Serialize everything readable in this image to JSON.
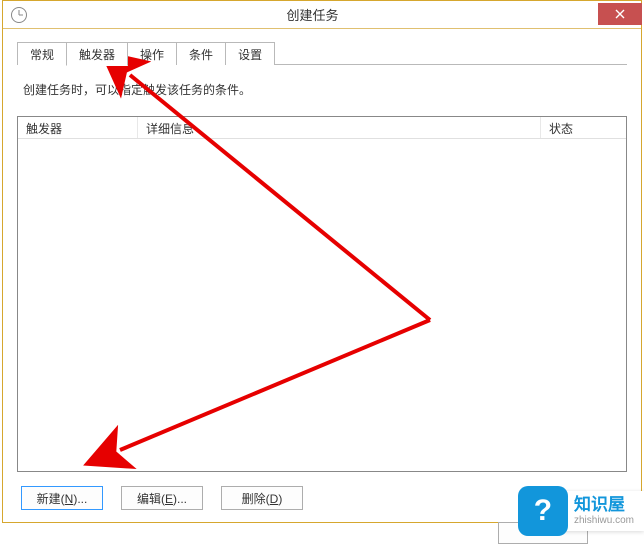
{
  "window": {
    "title": "创建任务"
  },
  "tabs": [
    {
      "label": "常规"
    },
    {
      "label": "触发器",
      "active": true
    },
    {
      "label": "操作"
    },
    {
      "label": "条件"
    },
    {
      "label": "设置"
    }
  ],
  "description": "创建任务时，可以指定触发该任务的条件。",
  "columns": {
    "c1": "触发器",
    "c2": "详细信息",
    "c3": "状态"
  },
  "buttons": {
    "new": "新建(N)...",
    "edit": "编辑(E)...",
    "delete": "删除(D)"
  },
  "watermark": {
    "brand_cn": "知识屋",
    "brand_en": "zhishiwu.com",
    "glyph": "?"
  }
}
